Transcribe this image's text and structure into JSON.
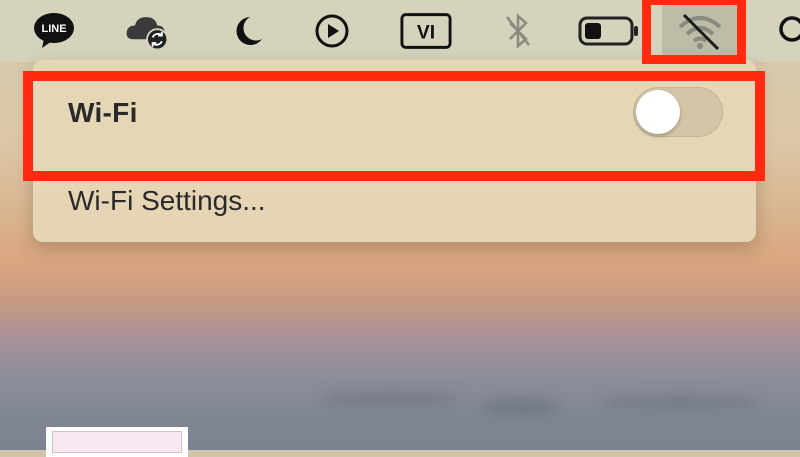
{
  "menubar": {
    "line_icon_text": "LINE",
    "input_source": "VI",
    "icons": [
      "line-icon",
      "cloud-sync-icon",
      "moon-icon",
      "play-circle-icon",
      "input-source-icon",
      "bluetooth-off-icon",
      "battery-icon",
      "wifi-off-icon",
      "search-icon"
    ]
  },
  "wifi_menu": {
    "title": "Wi-Fi",
    "toggle_state": "off",
    "settings_label": "Wi-Fi Settings..."
  },
  "colors": {
    "highlight": "#ff2a10",
    "panel": "#e5d6b6"
  }
}
